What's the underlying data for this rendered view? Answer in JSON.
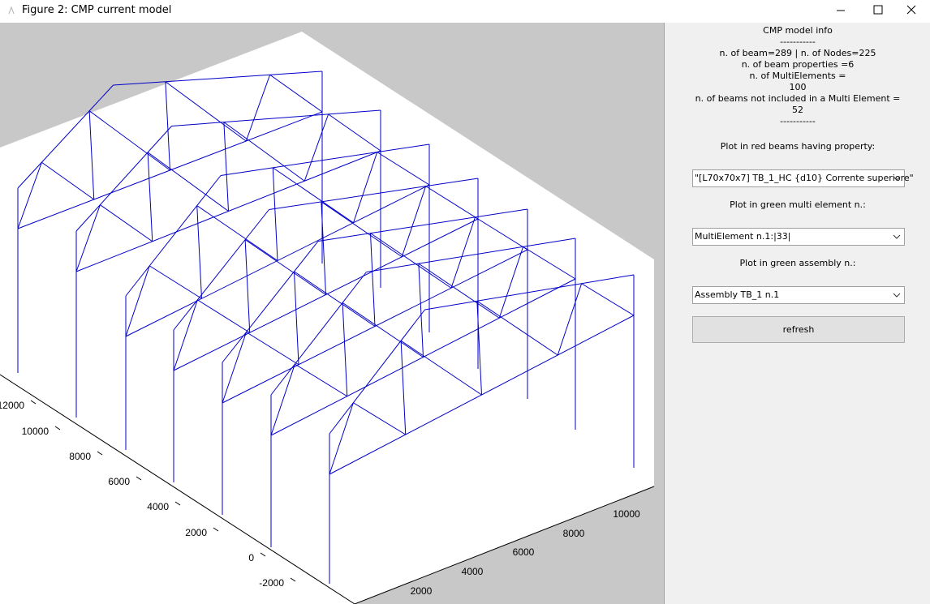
{
  "window": {
    "title": "Figure 2: CMP current model"
  },
  "panel": {
    "info_lines": [
      "CMP model info",
      "-----------",
      "n. of beam=289 | n. of Nodes=225",
      "n. of beam properties =6",
      "n. of MultiElements =",
      "100",
      "n. of beams not included in a Multi Element =",
      "52",
      "-----------"
    ],
    "property_label": "Plot in red beams having property:",
    "property_value": "\"[L70x70x7] TB_1_HC {d10} Corrente superiore\"",
    "multi_label": "Plot in green multi element n.:",
    "multi_value": "MultiElement n.1:|33|",
    "assembly_label": "Plot in green assembly n.:",
    "assembly_value": "Assembly TB_1 n.1",
    "refresh_label": "refresh"
  },
  "plot": {
    "line_color": "#0000c8",
    "y_ticks": [
      "12000",
      "10000",
      "8000",
      "6000",
      "4000",
      "2000",
      "0",
      "-2000"
    ],
    "x_ticks": [
      "2000",
      "4000",
      "6000",
      "8000",
      "10000"
    ]
  }
}
